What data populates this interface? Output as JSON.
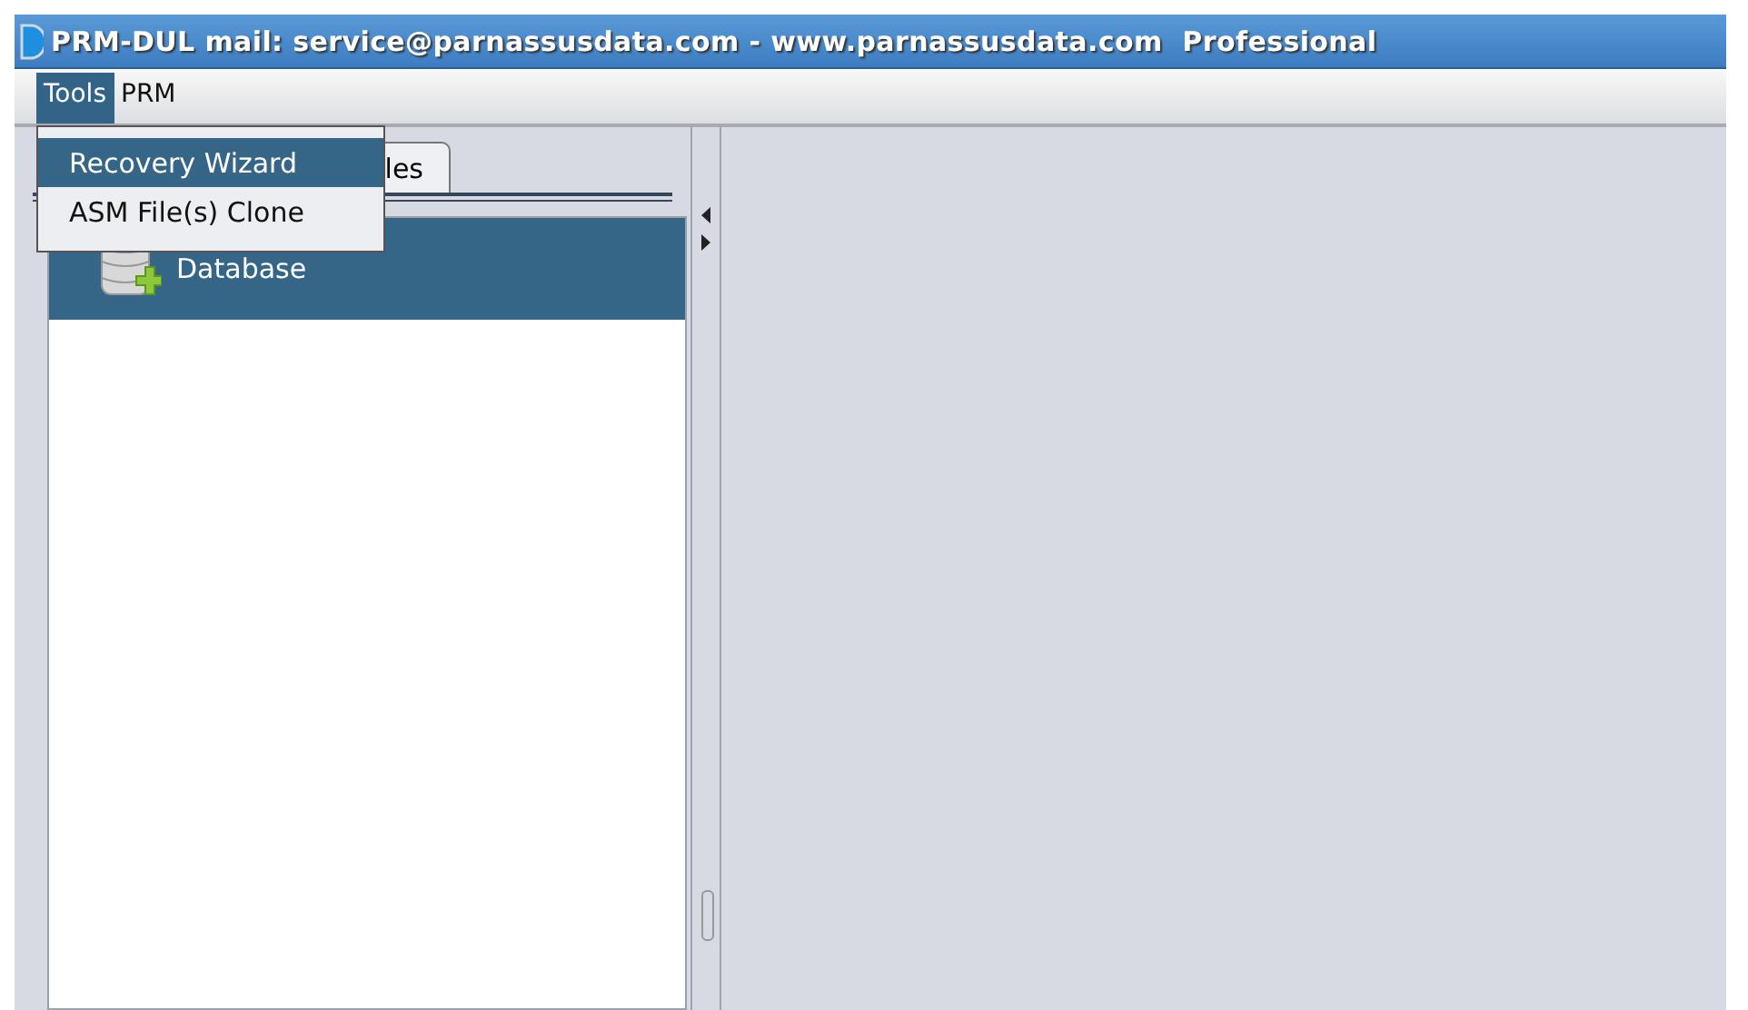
{
  "window": {
    "title": "PRM-DUL mail: service@parnassusdata.com - www.parnassusdata.com  Professional"
  },
  "menu_bar": [
    {
      "label": "Tools",
      "selected": true
    },
    {
      "label": "PRM",
      "selected": false
    }
  ],
  "dropdown": [
    {
      "label": "Recovery Wizard",
      "selected": true
    },
    {
      "label": "ASM File(s) Clone",
      "selected": false
    }
  ],
  "tabs": [
    {
      "label": "les",
      "selected": true
    }
  ],
  "tree": [
    {
      "label": "Database",
      "selected": true
    }
  ]
}
